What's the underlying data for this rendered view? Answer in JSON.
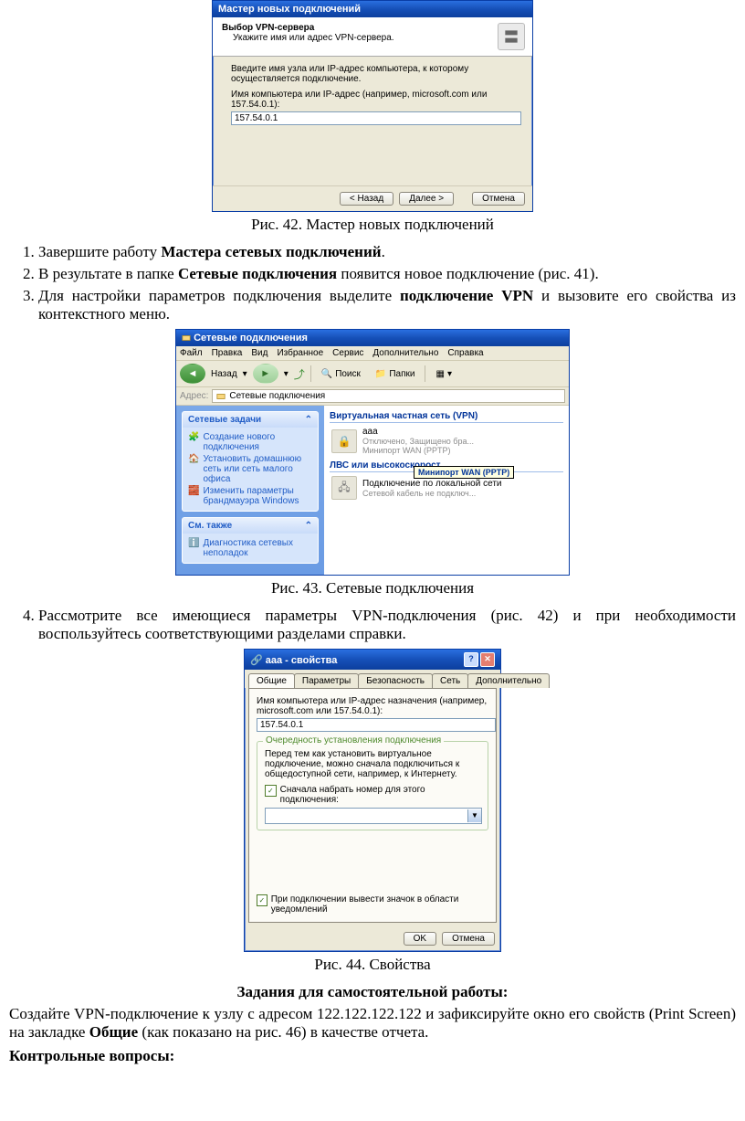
{
  "wizard": {
    "title": "Мастер новых подключений",
    "header_title": "Выбор VPN-сервера",
    "header_sub": "Укажите имя или адрес VPN-сервера.",
    "instr1": "Введите имя узла или IP-адрес компьютера, к  которому осуществляется подключение.",
    "instr2": "Имя компьютера или IP-адрес (например, microsoft.com или 157.54.0.1):",
    "ip_value": "157.54.0.1",
    "btn_back": "< Назад",
    "btn_next": "Далее >",
    "btn_cancel": "Отмена"
  },
  "captions": {
    "c42": "Рис. 42. Мастер новых подключений",
    "c43": "Рис. 43. Сетевые подключения",
    "c44": "Рис. 44. Свойства"
  },
  "steps": {
    "s1a": "Завершите работу ",
    "s1b": "Мастера сетевых подключений",
    "s1c": ".",
    "s2a": "В результате в папке ",
    "s2b": "Сетевые подключения",
    "s2c": " появится новое подключение (рис. 41).",
    "s3a": "Для настройки параметров подключения выделите ",
    "s3b": "подключение VPN",
    "s3c": " и вызовите его свойства из контекстного меню.",
    "s4": "Рассмотрите все имеющиеся параметры VPN-подключения (рис. 42) и при необходимости воспользуйтесь соответствующими разделами справки."
  },
  "explorer": {
    "title": "Сетевые подключения",
    "menu": [
      "Файл",
      "Правка",
      "Вид",
      "Избранное",
      "Сервис",
      "Дополнительно",
      "Справка"
    ],
    "back": "Назад",
    "search": "Поиск",
    "folders": "Папки",
    "addr_label": "Адрес:",
    "addr_value": "Сетевые подключения",
    "panel1_title": "Сетевые задачи",
    "panel1_items": [
      "Создание нового подключения",
      "Установить домашнюю сеть или сеть малого офиса",
      "Изменить параметры брандмауэра Windows"
    ],
    "panel2_title": "См. также",
    "panel2_item": "Диагностика сетевых неполадок",
    "group_vpn": "Виртуальная частная сеть (VPN)",
    "vpn_name": "aaa",
    "vpn_sub1": "Отключено, Защищено бра...",
    "vpn_sub2": "Минипорт WAN (PPTP)",
    "tooltip": "Минипорт WAN (PPTP)",
    "group_lan": "ЛВС или высокоскорост",
    "lan_name": "Подключение по локальной сети",
    "lan_sub": "Сетевой кабель не подключ..."
  },
  "props": {
    "title": "aaa - свойства",
    "tabs": [
      "Общие",
      "Параметры",
      "Безопасность",
      "Сеть",
      "Дополнительно"
    ],
    "label_host": "Имя компьютера или IP-адрес назначения (например, microsoft.com или 157.54.0.1):",
    "ip_value": "157.54.0.1",
    "group_title": "Очередность установления подключения",
    "group_text": "Перед тем как установить виртуальное подключение, можно сначала подключиться к общедоступной сети, например, к Интернету.",
    "chk_dial": "Сначала набрать номер для этого подключения:",
    "chk_tray": "При подключении вывести значок в области уведомлений",
    "btn_ok": "OK",
    "btn_cancel": "Отмена"
  },
  "task": {
    "title": "Задания для самостоятельной работы:",
    "p_a": "Создайте VPN-подключение к узлу с адресом 122.122.122.122 и зафиксируйте окно его свойств (Print Screen) на закладке ",
    "p_b": "Общие",
    "p_c": " (как показано на рис. 46) в качестве отчета."
  },
  "questions_title": "Контрольные вопросы:"
}
